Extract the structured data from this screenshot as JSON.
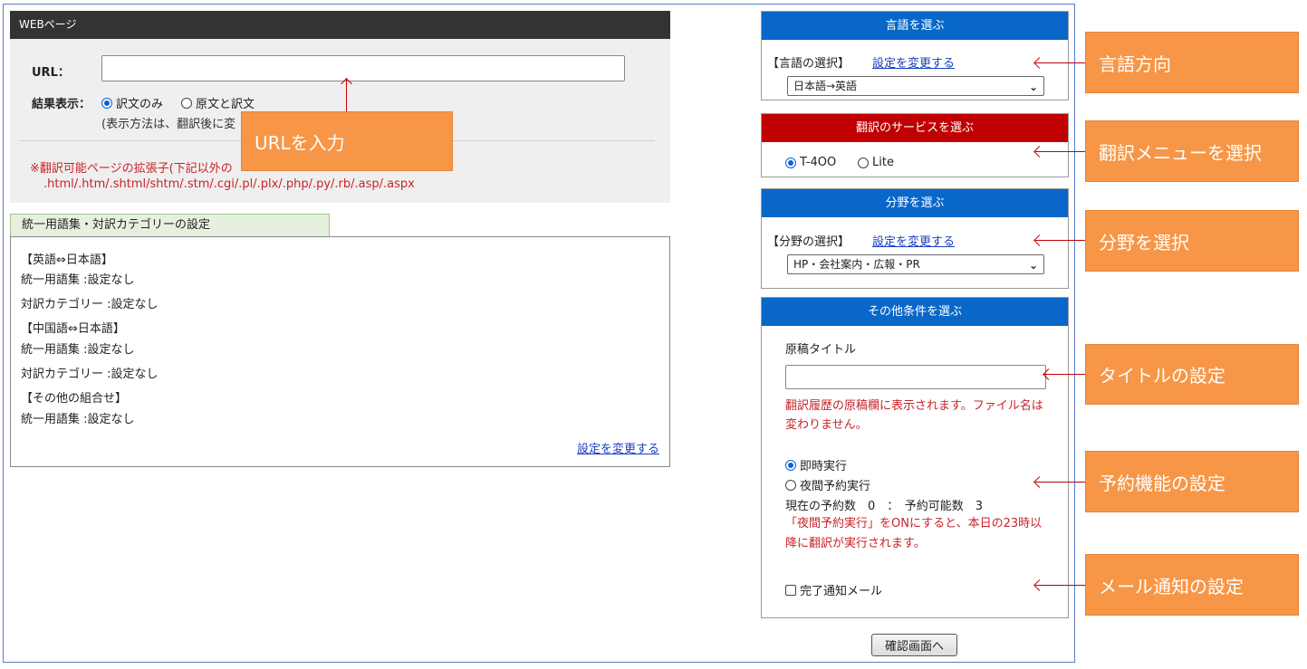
{
  "web_panel": {
    "header": "WEBページ",
    "url_label": "URL：",
    "url_value": "",
    "result_label": "結果表示：",
    "opt_translation_only": "訳文のみ",
    "opt_original_and_translation": "原文と訳文",
    "display_note": "(表示方法は、翻訳後に変",
    "ext_note": "※翻訳可能ページの拡張子(下記以外の",
    "ext_list": ".html/.htm/.shtml/shtm/.stm/.cgi/.pl/.plx/.php/.py/.rb/.asp/.aspx"
  },
  "glossary": {
    "tab_label": "統一用語集・対訳カテゴリーの設定",
    "lines": [
      "【英語⇔日本語】",
      "統一用語集 :設定なし",
      "対訳カテゴリー :設定なし",
      "【中国語⇔日本語】",
      "統一用語集 :設定なし",
      "対訳カテゴリー :設定なし",
      "【その他の組合せ】",
      "統一用語集 :設定なし"
    ],
    "change_link": "設定を変更する"
  },
  "language": {
    "header": "言語を選ぶ",
    "label": "【言語の選択】",
    "change_link": "設定を変更する",
    "selected": "日本語→英語"
  },
  "service": {
    "header": "翻訳のサービスを選ぶ",
    "opt1": "T-4OO",
    "opt2": "Lite"
  },
  "field": {
    "header": "分野を選ぶ",
    "label": "【分野の選択】",
    "change_link": "設定を変更する",
    "selected": "HP・会社案内・広報・PR"
  },
  "other": {
    "header": "その他条件を選ぶ",
    "title_label": "原稿タイトル",
    "title_value": "",
    "title_note_1": "翻訳履歴の原稿欄に表示されます。ファイル名は",
    "title_note_2": "変わりません。",
    "opt_immediate": "即時実行",
    "opt_night": "夜間予約実行",
    "reserve_status": "現在の予約数　0　：　予約可能数　3",
    "night_note_1": "「夜間予約実行」をONにすると、本日の23時以",
    "night_note_2": "降に翻訳が実行されます。",
    "mail_label": "完了通知メール"
  },
  "confirm_button": "確認画面へ",
  "annotations": {
    "url": "URLを入力",
    "language": "言語方向",
    "menu": "翻訳メニューを選択",
    "field": "分野を選択",
    "title": "タイトルの設定",
    "reserve": "予約機能の設定",
    "mail": "メール通知の設定"
  },
  "colors": {
    "header_blue": "#0867c8",
    "header_red": "#c00000",
    "callout_orange": "#f79646",
    "note_red": "#c8232a"
  }
}
